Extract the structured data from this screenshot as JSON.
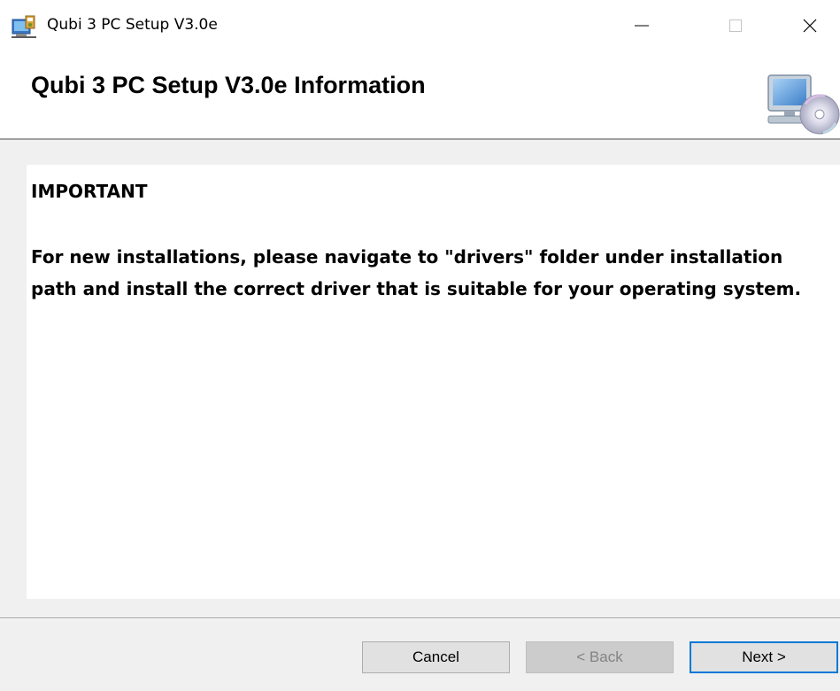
{
  "window": {
    "title": "Qubi 3 PC Setup V3.0e",
    "icons": {
      "app": "setup-installer-icon",
      "minimize": "minimize-icon",
      "maximize": "maximize-icon",
      "close": "close-icon"
    }
  },
  "header": {
    "heading": "Qubi 3 PC Setup V3.0e Information",
    "banner_icon": "computer-cd-icon"
  },
  "content": {
    "label": "IMPORTANT",
    "message": "For new installations, please navigate to \"drivers\" folder under installation path and install the correct driver that is suitable for your operating system."
  },
  "footer": {
    "cancel_label": "Cancel",
    "back_label": "< Back",
    "next_label": "Next >",
    "back_enabled": false,
    "accent_color": "#0078d7"
  }
}
